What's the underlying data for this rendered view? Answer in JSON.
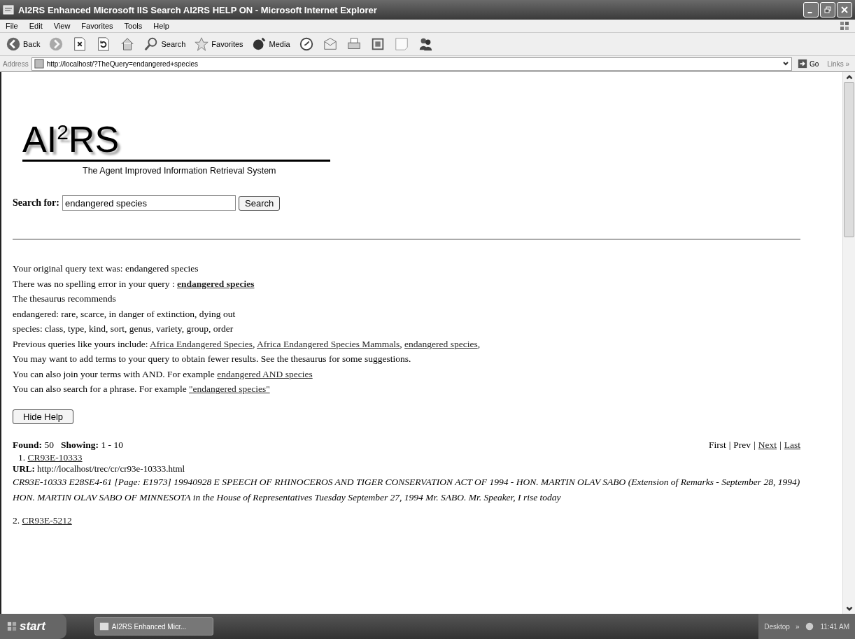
{
  "window": {
    "title": "AI2RS Enhanced Microsoft IIS Search AI2RS HELP ON - Microsoft Internet Explorer"
  },
  "menu": [
    "File",
    "Edit",
    "View",
    "Favorites",
    "Tools",
    "Help"
  ],
  "toolbar": [
    {
      "kind": "back",
      "label": "Back"
    },
    {
      "kind": "forward"
    },
    {
      "kind": "stop"
    },
    {
      "kind": "refresh"
    },
    {
      "kind": "home"
    },
    {
      "kind": "search",
      "label": "Search"
    },
    {
      "kind": "favorites",
      "label": "Favorites"
    },
    {
      "kind": "media",
      "label": "Media"
    },
    {
      "kind": "history"
    },
    {
      "kind": "mail"
    },
    {
      "kind": "print"
    },
    {
      "kind": "edit"
    },
    {
      "kind": "discuss"
    },
    {
      "kind": "messenger"
    }
  ],
  "address": {
    "label": "Address",
    "value": "http://localhost/?TheQuery=endangered+species",
    "go": "Go",
    "links": "Links",
    "links_more": "»"
  },
  "page": {
    "logo": "AI$^{2}$RS",
    "tagline": "The Agent Improved Information Retrieval System",
    "search": {
      "label": "Search for:",
      "value": "endangered species",
      "button": "Search"
    },
    "help_lines": [
      [
        {
          "kind": "text",
          "text": "Your original query text was: endangered species"
        }
      ],
      [
        {
          "kind": "text",
          "text": "There was no spelling error in your query : "
        },
        {
          "kind": "boldlink",
          "text": "endangered species"
        }
      ],
      [
        {
          "kind": "text",
          "text": "The thesaurus recommends"
        }
      ],
      [
        {
          "kind": "text",
          "text": "endangered: rare, scarce, in danger of extinction, dying out"
        }
      ],
      [
        {
          "kind": "text",
          "text": "species: class, type, kind, sort, genus, variety, group, order"
        }
      ],
      [
        {
          "kind": "text",
          "text": "Previous queries like yours include: "
        },
        {
          "kind": "link",
          "text": "Africa Endangered Species"
        },
        {
          "kind": "text",
          "text": ", "
        },
        {
          "kind": "link",
          "text": "Africa Endangered Species Mammals"
        },
        {
          "kind": "text",
          "text": ", "
        },
        {
          "kind": "link",
          "text": "endangered species"
        },
        {
          "kind": "text",
          "text": ","
        }
      ],
      [
        {
          "kind": "text",
          "text": "You may want to add terms to your query to obtain fewer results. See the thesaurus for some suggestions."
        }
      ],
      [
        {
          "kind": "text",
          "text": "You can also join your terms with AND. For example "
        },
        {
          "kind": "link",
          "text": "endangered AND species"
        }
      ],
      [
        {
          "kind": "text",
          "text": "You can also search for a phrase. For example "
        },
        {
          "kind": "link",
          "text": "\"endangered species\""
        }
      ]
    ],
    "hide_help": "Hide Help",
    "found": {
      "label": "Found:",
      "value": "50",
      "showing_label": "Showing:",
      "showing": "1 - 10"
    },
    "pager": {
      "separator": "|",
      "items": [
        {
          "text": "First",
          "link": false
        },
        {
          "text": "Prev",
          "link": false
        },
        {
          "text": "Next",
          "link": true
        },
        {
          "text": "Last",
          "link": true
        }
      ]
    },
    "results": [
      {
        "number": "1.",
        "title": "CR93E-10333",
        "url_label": "URL:",
        "url": "http://localhost/trec/cr/cr93e-10333.html",
        "snippet": "CR93E-10333 E28SE4-61 [Page: E1973] 19940928 E SPEECH OF RHINOCEROS AND TIGER CONSERVATION ACT OF 1994 - HON. MARTIN OLAV SABO (Extension of Remarks - September 28, 1994) HON. MARTIN OLAV SABO OF MINNESOTA in the House of Representatives Tuesday September 27, 1994 Mr. SABO. Mr. Speaker, I rise today"
      },
      {
        "number": "2.",
        "title": "CR93E-5212"
      }
    ]
  },
  "taskbar": {
    "start": "start",
    "tasks": [
      "AI2RS Enhanced Micr..."
    ],
    "tray_label": "Desktop",
    "tray_more": "»",
    "clock": "11:41 AM"
  }
}
